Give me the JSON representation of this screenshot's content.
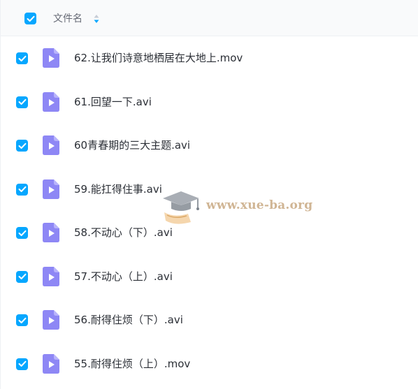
{
  "header": {
    "column_label": "文件名",
    "select_all_checked": true
  },
  "files": [
    {
      "name": "62.让我们诗意地栖居在大地上.mov",
      "checked": true,
      "icon": "video-file-icon"
    },
    {
      "name": "61.回望一下.avi",
      "checked": true,
      "icon": "video-file-icon"
    },
    {
      "name": "60青春期的三大主题.avi",
      "checked": true,
      "icon": "video-file-icon"
    },
    {
      "name": "59.能扛得住事.avi",
      "checked": true,
      "icon": "video-file-icon"
    },
    {
      "name": "58.不动心（下）.avi",
      "checked": true,
      "icon": "video-file-icon"
    },
    {
      "name": "57.不动心（上）.avi",
      "checked": true,
      "icon": "video-file-icon"
    },
    {
      "name": "56.耐得住烦（下）.avi",
      "checked": true,
      "icon": "video-file-icon"
    },
    {
      "name": "55.耐得住烦（上）.mov",
      "checked": true,
      "icon": "video-file-icon"
    }
  ],
  "watermark": {
    "text": "www.xue-ba.org"
  },
  "colors": {
    "accent": "#06a7ff",
    "file_icon": "#8e87f5",
    "text": "#2b2f36",
    "header_bg": "#f9fafb"
  }
}
